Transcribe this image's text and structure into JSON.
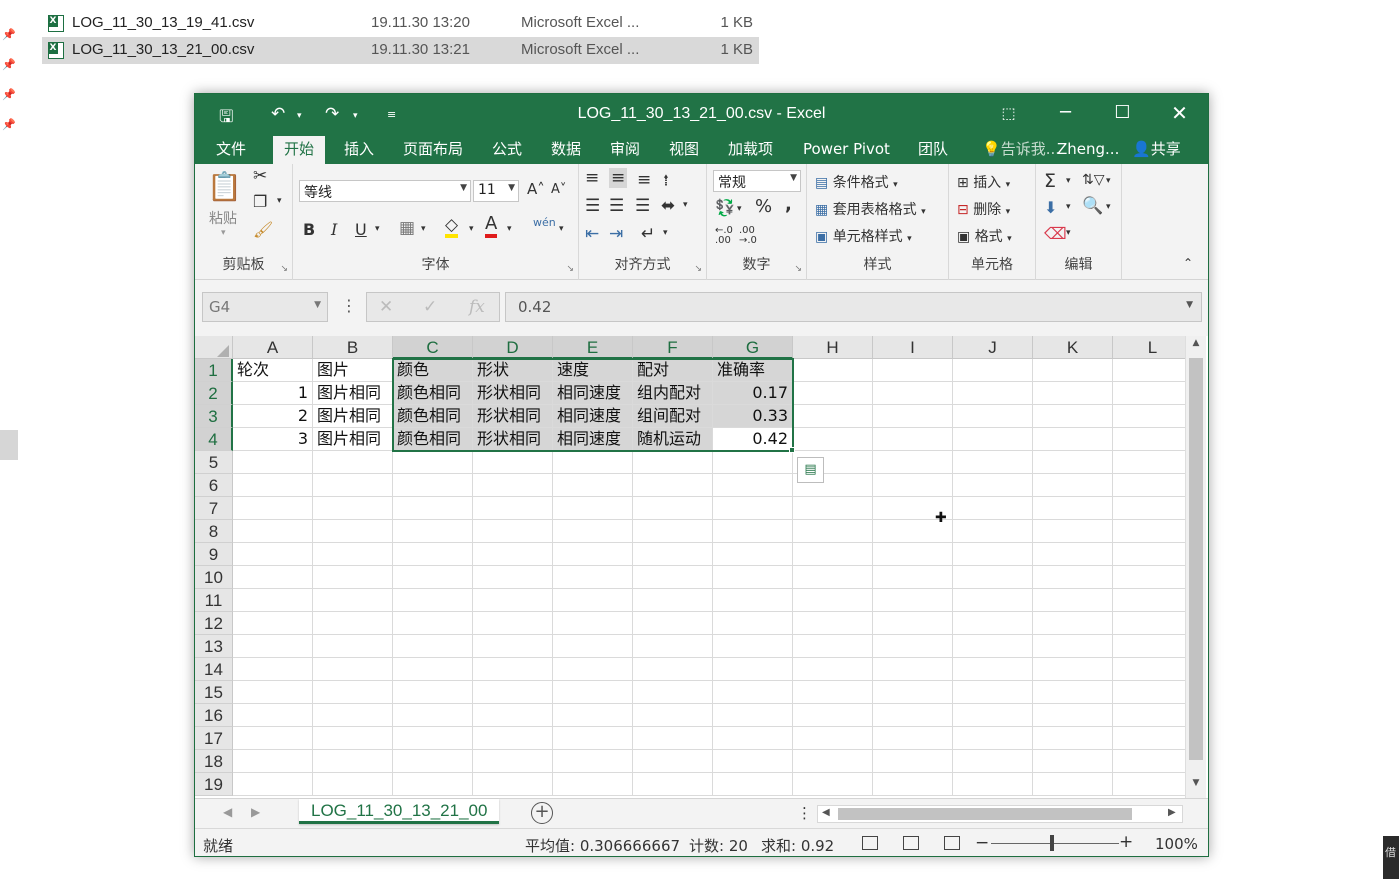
{
  "explorer": {
    "files": [
      {
        "name": "LOG_11_30_13_19_41.csv",
        "date": "19.11.30 13:20",
        "type": "Microsoft Excel ...",
        "size": "1 KB"
      },
      {
        "name": "LOG_11_30_13_21_00.csv",
        "date": "19.11.30 13:21",
        "type": "Microsoft Excel ...",
        "size": "1 KB"
      }
    ],
    "corner_tip": "借"
  },
  "window": {
    "title": "LOG_11_30_13_21_00.csv  -  Excel"
  },
  "ribbon": {
    "tabs": [
      {
        "label": "文件"
      },
      {
        "label": "开始"
      },
      {
        "label": "插入"
      },
      {
        "label": "页面布局"
      },
      {
        "label": "公式"
      },
      {
        "label": "数据"
      },
      {
        "label": "审阅"
      },
      {
        "label": "视图"
      },
      {
        "label": "加载项"
      },
      {
        "label": "Power Pivot"
      },
      {
        "label": "团队"
      },
      {
        "label": "告诉我..."
      },
      {
        "label": "Zheng..."
      },
      {
        "label": "共享"
      }
    ],
    "clipboard": {
      "paste": "粘贴",
      "label": "剪贴板"
    },
    "font": {
      "name": "等线",
      "size": "11",
      "bold": "B",
      "italic": "I",
      "underline": "U",
      "wen": "wén",
      "label": "字体"
    },
    "alignment": {
      "label": "对齐方式"
    },
    "number": {
      "format": "常规",
      "percent": "%",
      "comma": ",",
      "label": "数字"
    },
    "styles": {
      "conditional": "条件格式",
      "table": "套用表格格式",
      "cell": "单元格样式",
      "label": "样式"
    },
    "cells": {
      "insert": "插入",
      "delete": "删除",
      "format": "格式",
      "label": "单元格"
    },
    "editing": {
      "label": "编辑"
    }
  },
  "formula_bar": {
    "name_box": "G4",
    "value": "0.42",
    "fx": "fx"
  },
  "grid": {
    "columns": [
      "A",
      "B",
      "C",
      "D",
      "E",
      "F",
      "G",
      "H",
      "I",
      "J",
      "K",
      "L"
    ],
    "rows": [
      "1",
      "2",
      "3",
      "4",
      "5",
      "6",
      "7",
      "8",
      "9",
      "10",
      "11",
      "12",
      "13",
      "14",
      "15",
      "16",
      "17",
      "18",
      "19"
    ],
    "cells": [
      [
        "轮次",
        "图片",
        "颜色",
        "形状",
        "速度",
        "配对",
        "准确率"
      ],
      [
        "1",
        "图片相同",
        "颜色相同",
        "形状相同",
        "相同速度",
        "组内配对",
        "0.17"
      ],
      [
        "2",
        "图片相同",
        "颜色相同",
        "形状相同",
        "相同速度",
        "组间配对",
        "0.33"
      ],
      [
        "3",
        "图片相同",
        "颜色相同",
        "形状相同",
        "相同速度",
        "随机运动",
        "0.42"
      ]
    ]
  },
  "sheet": {
    "tab": "LOG_11_30_13_21_00",
    "add": "+"
  },
  "status": {
    "ready": "就绪",
    "average": "平均值: 0.306666667",
    "count": "计数: 20",
    "sum": "求和: 0.92",
    "zoom": "100%",
    "minus": "−",
    "plus": "+"
  }
}
